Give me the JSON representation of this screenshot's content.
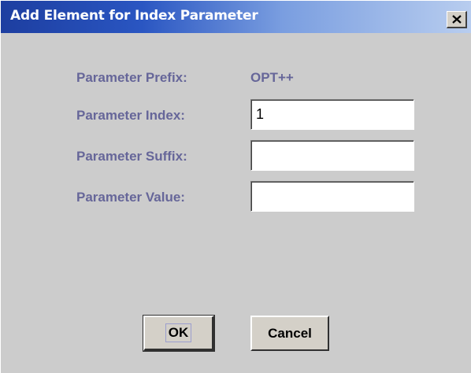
{
  "dialog": {
    "title": "Add Element for Index Parameter"
  },
  "form": {
    "prefix_label": "Parameter Prefix:",
    "prefix_value": "OPT++",
    "index_label": "Parameter Index:",
    "index_value": "1",
    "suffix_label": "Parameter Suffix:",
    "suffix_value": "",
    "value_label": "Parameter Value:",
    "value_value": ""
  },
  "buttons": {
    "ok_label": "OK",
    "cancel_label": "Cancel"
  },
  "colors": {
    "title_bar_start": "#1d3ea0",
    "title_bar_end": "#b8cdef",
    "label_text": "#666699",
    "dialog_background": "#cccccc"
  },
  "icons": {
    "close": "close-icon"
  }
}
